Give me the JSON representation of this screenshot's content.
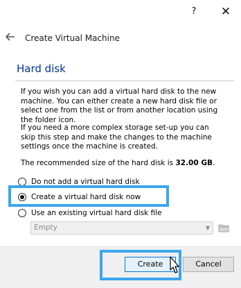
{
  "titlebar": {
    "help_label": "?",
    "close_label": "✕"
  },
  "nav": {
    "title": "Create Virtual Machine"
  },
  "section": {
    "title": "Hard disk"
  },
  "paragraphs": {
    "p1": "If you wish you can add a virtual hard disk to the new machine. You can either create a new hard disk file or select one from the list or from another location using the folder icon.",
    "p2": "If you need a more complex storage set-up you can skip this step and make the changes to the machine settings once the machine is created.",
    "p3_prefix": "The recommended size of the hard disk is ",
    "p3_size": "32.00 GB",
    "p3_suffix": "."
  },
  "options": [
    {
      "label": "Do not add a virtual hard disk",
      "selected": false
    },
    {
      "label": "Create a virtual hard disk now",
      "selected": true
    },
    {
      "label": "Use an existing virtual hard disk file",
      "selected": false
    }
  ],
  "combo": {
    "value": "Empty"
  },
  "footer": {
    "create_label": "Create",
    "cancel_label": "Cancel"
  },
  "icons": {
    "back": "back-arrow-icon",
    "folder": "folder-icon",
    "cursor": "mouse-pointer-icon"
  },
  "colors": {
    "accent": "#3ba6ee",
    "title": "#003399"
  }
}
